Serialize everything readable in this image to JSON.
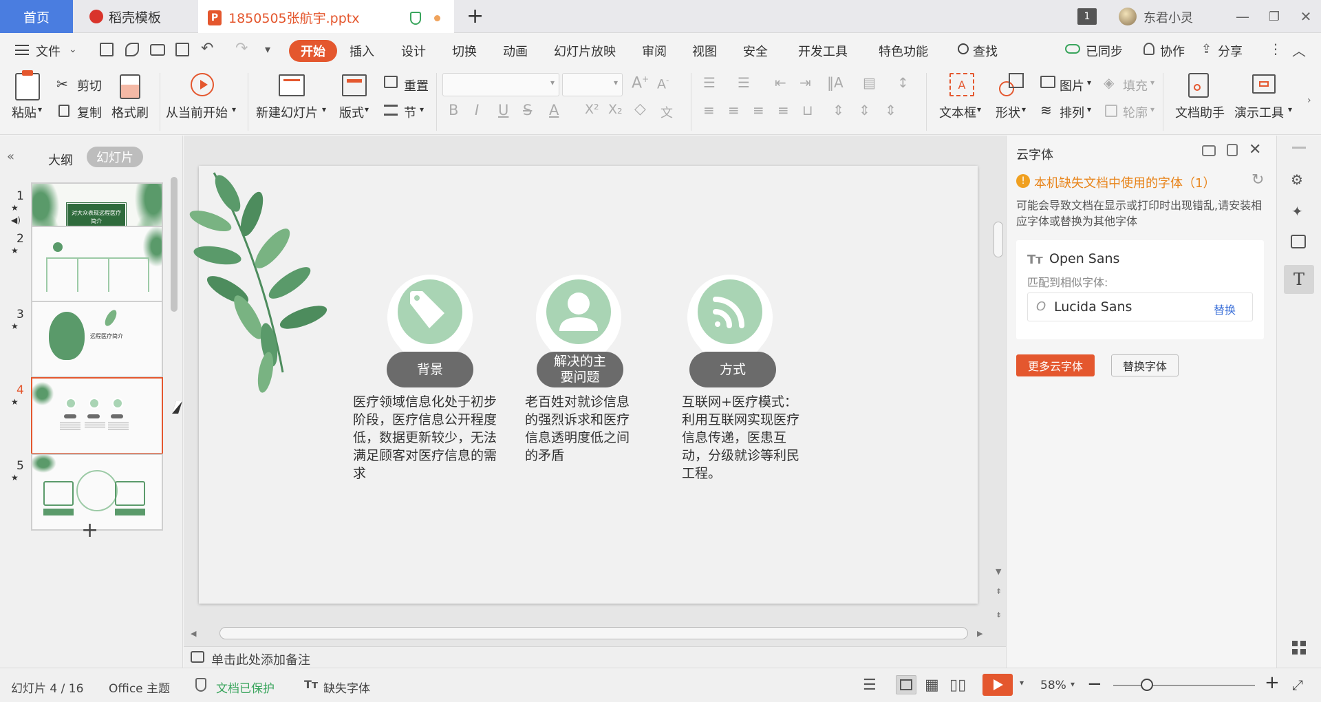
{
  "titlebar": {
    "home_tab": "首页",
    "template_tab": "稻壳模板",
    "doc_tab": "1850505张航宇.pptx",
    "new_tab": "+",
    "badge": "1",
    "user": "东君小灵"
  },
  "menu": {
    "file": "文件",
    "items": [
      "开始",
      "插入",
      "设计",
      "切换",
      "动画",
      "幻灯片放映",
      "审阅",
      "视图",
      "安全",
      "开发工具",
      "特色功能"
    ],
    "search": "查找",
    "sync": "已同步",
    "collab": "协作",
    "share": "分享"
  },
  "ribbon": {
    "paste": "粘贴",
    "cut": "剪切",
    "copy": "复制",
    "format_painter": "格式刷",
    "play_from_current": "从当前开始",
    "new_slide": "新建幻灯片",
    "layout": "版式",
    "reset": "重置",
    "section": "节",
    "textbox": "文本框",
    "shape": "形状",
    "picture": "图片",
    "fill": "填充",
    "arrange": "排列",
    "outline": "轮廓",
    "doc_helper": "文档助手",
    "present_tools": "演示工具"
  },
  "left_panel": {
    "outline_tab": "大纲",
    "slides_tab": "幻灯片",
    "slide_numbers": [
      "1",
      "2",
      "3",
      "4",
      "5"
    ],
    "selected": "4",
    "add_button": "+",
    "thumb1_title": "对大众表现远程医疗简介",
    "thumb3_title": "远程医疗简介"
  },
  "slide": {
    "pill1": "背景",
    "pill2": "解决的主要问题",
    "pill3": "方式",
    "text1": "医疗领域信息化处于初步阶段，医疗信息公开程度低，数据更新较少，无法满足顾客对医疗信息的需求",
    "text2": "老百姓对就诊信息的强烈诉求和医疗信息透明度低之间的矛盾",
    "text3": "互联网+医疗模式：利用互联网实现医疗信息传递，医患互动，分级就诊等利民工程。",
    "accent": "#a9d4b4"
  },
  "notes": {
    "placeholder": "单击此处添加备注"
  },
  "cloud_font": {
    "title": "云字体",
    "warning": "本机缺失文档中使用的字体（1）",
    "desc": "可能会导致文档在显示或打印时出现错乱,请安装相应字体或替换为其他字体",
    "missing_font": "Open Sans",
    "match_label": "匹配到相似字体:",
    "matched_font": "Lucida Sans",
    "replace_link": "替换",
    "more_button": "更多云字体",
    "replace_button": "替换字体"
  },
  "status": {
    "slide_count": "幻灯片 4 / 16",
    "theme": "Office 主题",
    "protected": "文档已保护",
    "missing_font": "缺失字体",
    "zoom": "58%",
    "zoom_level": 0.58
  },
  "colors": {
    "accent_orange": "#e4572e",
    "home_blue": "#4a7de0",
    "leaf_green": "#5a9a6a"
  }
}
